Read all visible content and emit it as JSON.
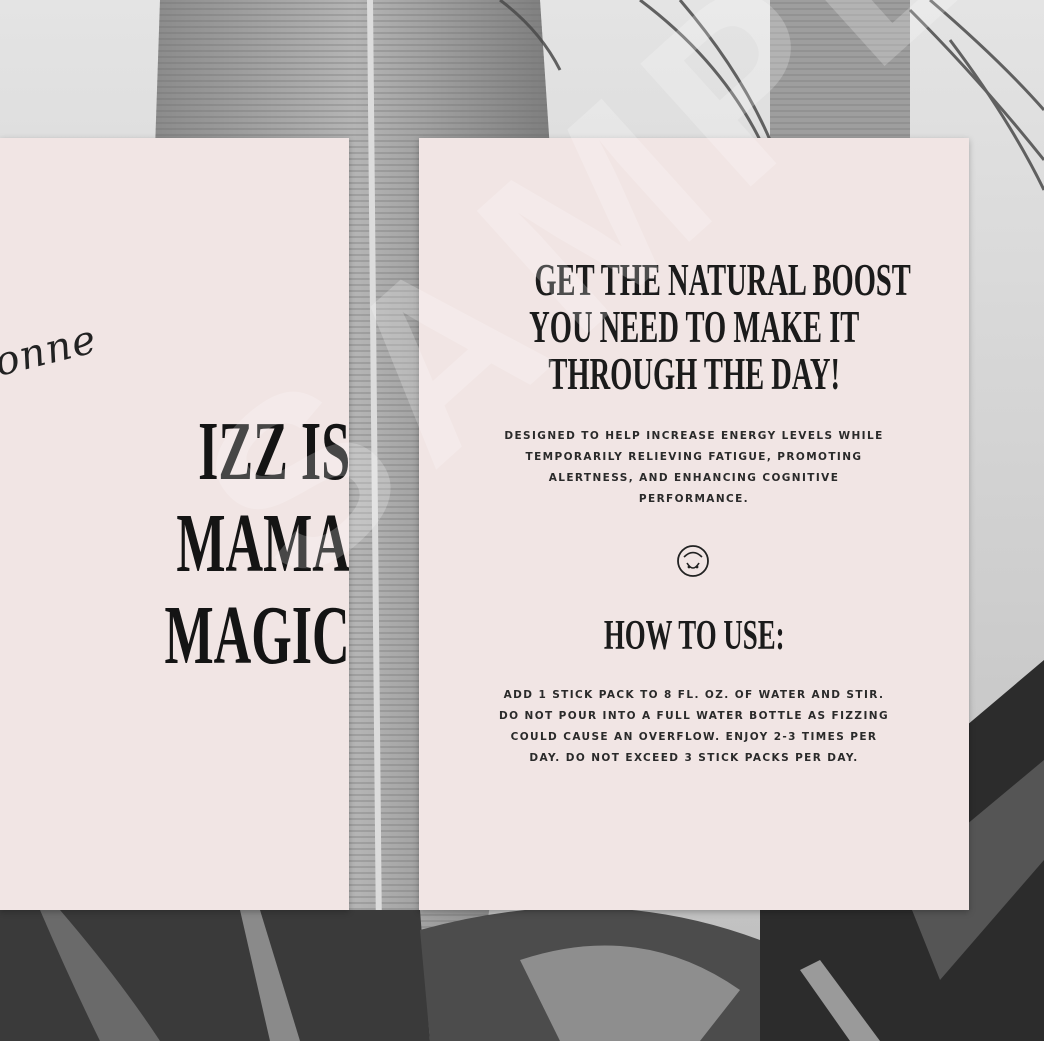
{
  "left_card": {
    "script_text": "onne",
    "headline_lines": [
      "IZZ IS",
      "MAMA",
      "MAGIC"
    ]
  },
  "right_card": {
    "headline_lines": [
      "GET THE NATURAL BOOST",
      "YOU NEED TO MAKE IT",
      "THROUGH THE DAY!"
    ],
    "description": "Designed to help increase energy levels while temporarily relieving fatigue, promoting alertness, and enhancing cognitive performance.",
    "icon": "smile-icon",
    "how_to_title": "HOW TO USE:",
    "instructions": "Add 1 stick pack to 8 fl. oz. of water and stir. Do not pour into a full water bottle as fizzing could cause an overflow. Enjoy 2-3 times per day. Do not exceed 3 stick packs per day."
  },
  "watermark": "SAMPLE",
  "colors": {
    "card": "#f1e5e4",
    "ink": "#1b1b1b"
  }
}
